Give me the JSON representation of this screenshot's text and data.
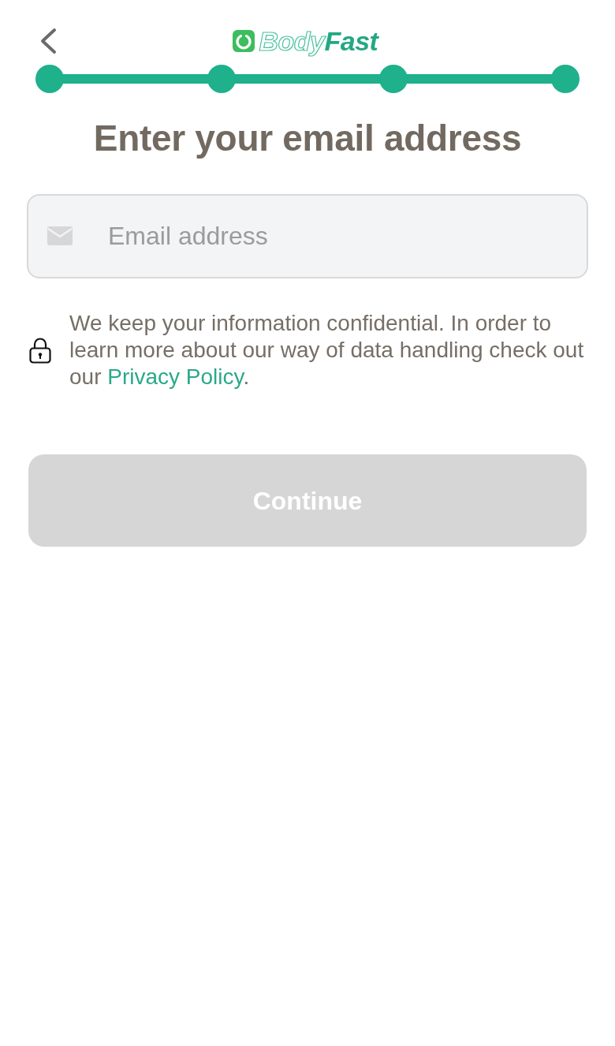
{
  "header": {
    "brand": {
      "outlined": "Body",
      "solid": "Fast"
    }
  },
  "progress": {
    "steps": [
      {
        "completed": true
      },
      {
        "completed": true
      },
      {
        "completed": true
      },
      {
        "completed": true
      }
    ]
  },
  "title": "Enter your email address",
  "email_field": {
    "placeholder": "Email address"
  },
  "notice": {
    "text_before": "We keep your information confidential. In order to learn more about our way of data handling check out our ",
    "link": "Privacy Policy",
    "text_after": "."
  },
  "continue_button": {
    "label": "Continue",
    "disabled": true
  }
}
